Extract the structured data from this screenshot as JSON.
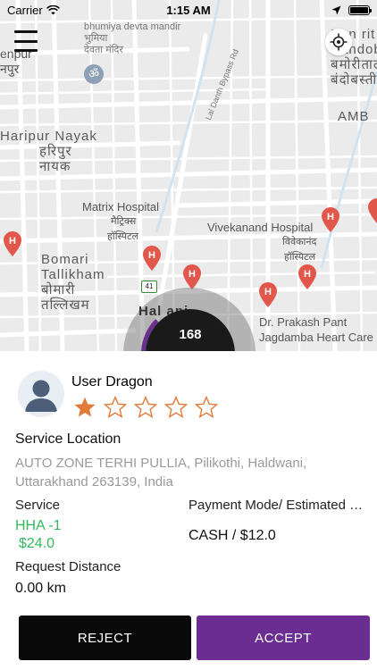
{
  "status_bar": {
    "carrier": "Carrier",
    "time": "1:15 AM"
  },
  "map": {
    "labels": {
      "bhumiya_en": "bhumiya devta mandir",
      "bhumiya_hi1": "भुमिया",
      "bhumiya_hi2": "देवता मंदिर",
      "nagpur_en": "enpur",
      "nagpur_hi": "नपुर",
      "banbhoolpura_en1": "Ban  rit a",
      "banbhoolpura_en2": "Bandobast",
      "banbhoolpura_hi1": "बमोरीताल",
      "banbhoolpura_hi2": "बंदोबस्ती",
      "amb": "AMB",
      "haripur_en": "Haripur Nayak",
      "haripur_hi1": "हरिपुर",
      "haripur_hi2": "नायक",
      "matrix_en": "Matrix Hospital",
      "matrix_hi1": "मैट्रिक्स",
      "matrix_hi2": "हॉस्पिटल",
      "vivekanand_en": "Vivekanand Hospital",
      "vivekanand_hi1": "विवेकानंद",
      "vivekanand_hi2": "हॉस्पिटल",
      "bomari_en1": "Bomari",
      "bomari_en2": "Tallikham",
      "bomari_hi1": "बोमारी",
      "bomari_hi2": "तल्लिखम",
      "haldwani": "Hal   ani",
      "prakash1": "Dr. Prakash Pant",
      "prakash2": "Jagdamba Heart Care",
      "bypass_road": "Lal Danth Bypass Rd",
      "highway": "41"
    },
    "timer": "168"
  },
  "request": {
    "user_name": "User Dragon",
    "rating": 1,
    "rating_max": 5,
    "service_location_label": "Service Location",
    "address_line1": "AUTO ZONE TERHI PULLIA, Pilikothi, Haldwani,",
    "address_line2": "Uttarakhand 263139, India",
    "service_label": "Service",
    "service_code": "HHA -1",
    "service_price": "$24.0",
    "payment_label": "Payment  Mode/ Estimated Price",
    "payment_value": "CASH / $12.0",
    "distance_label": "Request Distance",
    "distance_value": "0.00 km"
  },
  "actions": {
    "reject": "REJECT",
    "accept": "ACCEPT"
  },
  "colors": {
    "accent": "#6b2d91",
    "price_green": "#33b85e",
    "star": "#e07b39",
    "hospital_pin": "#e2574c"
  }
}
